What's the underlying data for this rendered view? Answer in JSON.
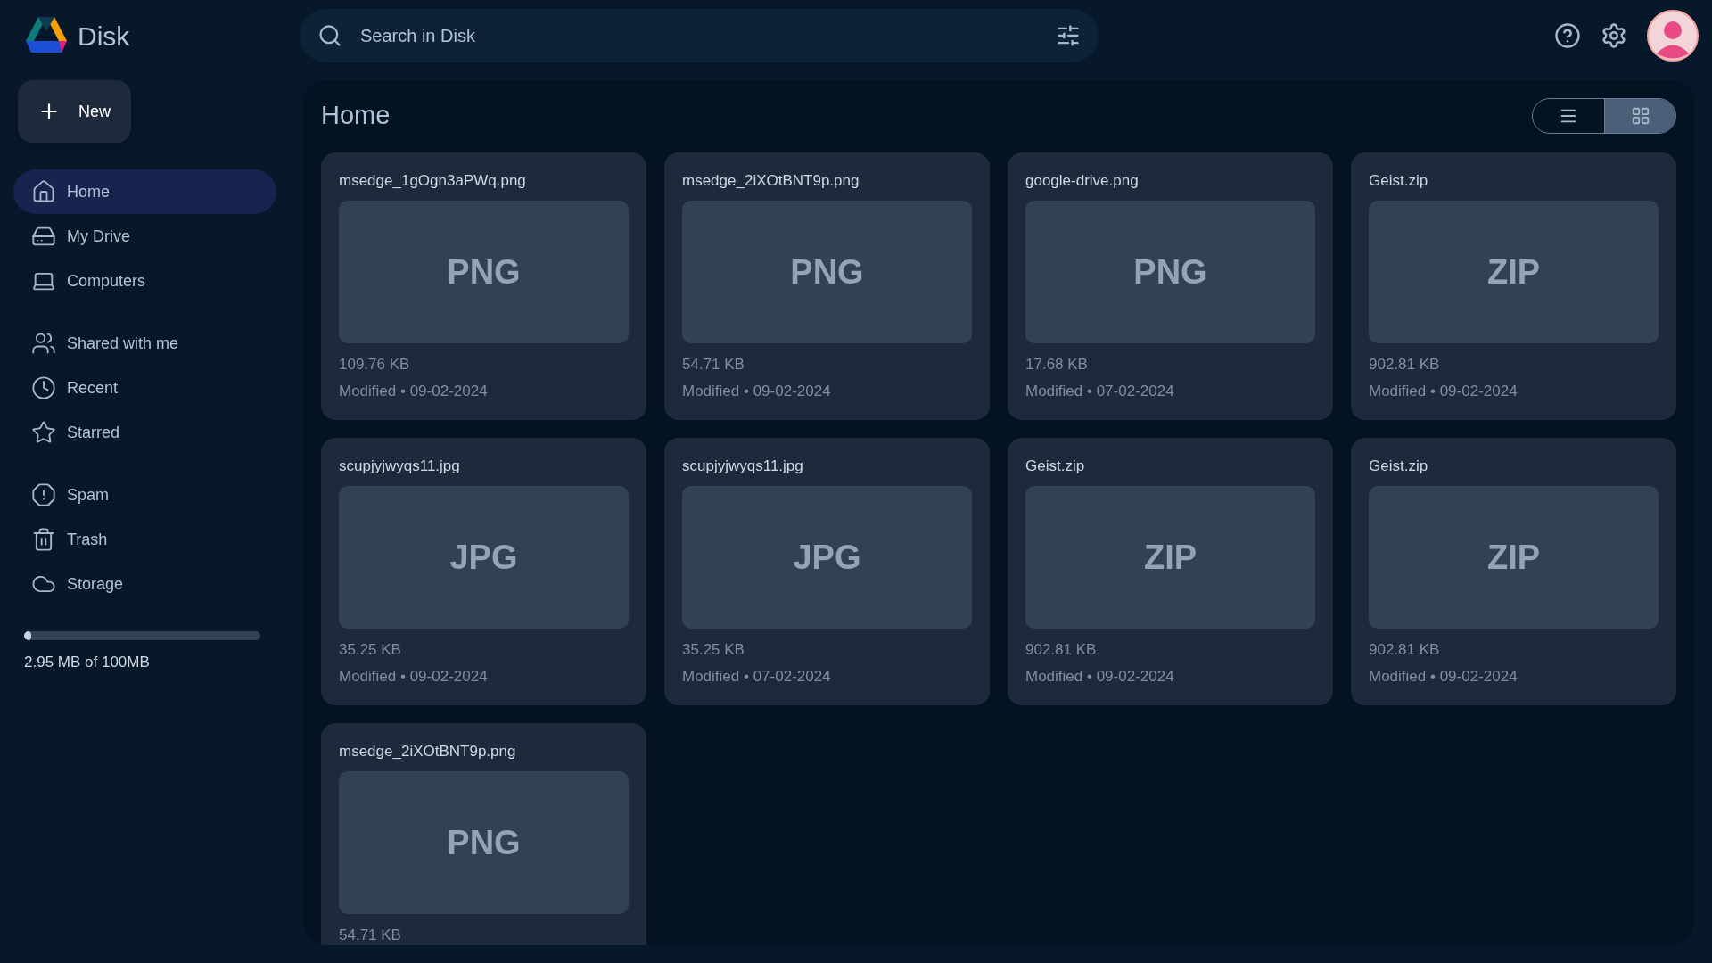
{
  "app": {
    "name": "Disk"
  },
  "new_button": {
    "label": "New"
  },
  "sidebar": {
    "groups": [
      [
        {
          "label": "Home",
          "selected": true
        },
        {
          "label": "My Drive",
          "selected": false
        },
        {
          "label": "Computers",
          "selected": false
        }
      ],
      [
        {
          "label": "Shared with me",
          "selected": false
        },
        {
          "label": "Recent",
          "selected": false
        },
        {
          "label": "Starred",
          "selected": false
        }
      ],
      [
        {
          "label": "Spam",
          "selected": false
        },
        {
          "label": "Trash",
          "selected": false
        },
        {
          "label": "Storage",
          "selected": false
        }
      ]
    ]
  },
  "storage": {
    "level": 0.03,
    "text": "2.95 MB of 100MB"
  },
  "search": {
    "placeholder": "Search in Disk"
  },
  "main": {
    "title": "Home",
    "view_toggle": [
      {
        "kind": "list",
        "selected": false
      },
      {
        "kind": "grid",
        "selected": true
      }
    ]
  },
  "files": [
    {
      "name": "msedge_1gOgn3aPWq.png",
      "type": "PNG",
      "size": "109.76 KB",
      "modified": "Modified • 09-02-2024"
    },
    {
      "name": "msedge_2iXOtBNT9p.png",
      "type": "PNG",
      "size": "54.71 KB",
      "modified": "Modified • 09-02-2024"
    },
    {
      "name": "google-drive.png",
      "type": "PNG",
      "size": "17.68 KB",
      "modified": "Modified • 07-02-2024"
    },
    {
      "name": "Geist.zip",
      "type": "ZIP",
      "size": "902.81 KB",
      "modified": "Modified • 09-02-2024"
    },
    {
      "name": "scupjyjwyqs11.jpg",
      "type": "JPG",
      "size": "35.25 KB",
      "modified": "Modified • 09-02-2024"
    },
    {
      "name": "scupjyjwyqs11.jpg",
      "type": "JPG",
      "size": "35.25 KB",
      "modified": "Modified • 07-02-2024"
    },
    {
      "name": "Geist.zip",
      "type": "ZIP",
      "size": "902.81 KB",
      "modified": "Modified • 09-02-2024"
    },
    {
      "name": "Geist.zip",
      "type": "ZIP",
      "size": "902.81 KB",
      "modified": "Modified • 09-02-2024"
    },
    {
      "name": "msedge_2iXOtBNT9p.png",
      "type": "PNG",
      "size": "54.71 KB"
    }
  ]
}
